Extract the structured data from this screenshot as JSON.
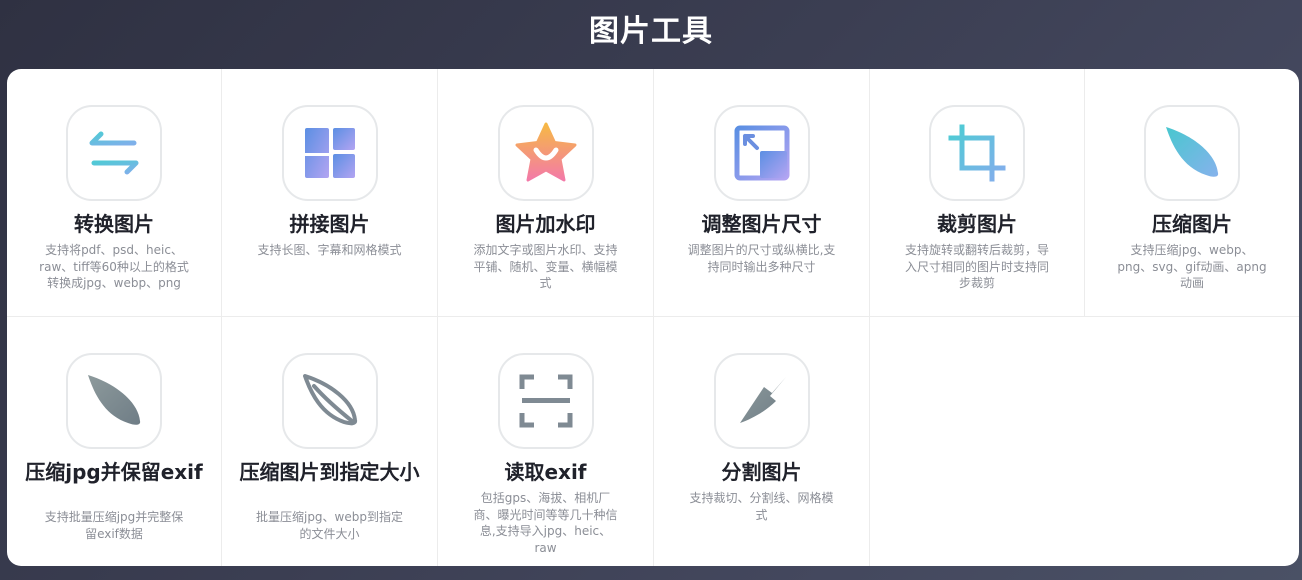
{
  "header": {
    "title": "图片工具"
  },
  "tools": [
    {
      "title": "转换图片",
      "desc": "支持将pdf、psd、heic、raw、tiff等60种以上的格式转换成jpg、webp、png",
      "icon": "convert-arrows-icon"
    },
    {
      "title": "拼接图片",
      "desc": "支持长图、字幕和网格模式",
      "icon": "grid-layout-icon"
    },
    {
      "title": "图片加水印",
      "desc": "添加文字或图片水印、支持平铺、随机、变量、横幅模式",
      "icon": "star-watermark-icon"
    },
    {
      "title": "调整图片尺寸",
      "desc": "调整图片的尺寸或纵横比,支持同时输出多种尺寸",
      "icon": "resize-icon"
    },
    {
      "title": "裁剪图片",
      "desc": "支持旋转或翻转后裁剪，导入尺寸相同的图片时支持同步裁剪",
      "icon": "crop-icon"
    },
    {
      "title": "压缩图片",
      "desc": "支持压缩jpg、webp、png、svg、gif动画、apng动画",
      "icon": "leaf-icon"
    },
    {
      "title": "压缩jpg并保留exif",
      "desc": "支持批量压缩jpg并完整保留exif数据",
      "icon": "leaf-gray-icon"
    },
    {
      "title": "压缩图片到指定大小",
      "desc": "批量压缩jpg、webp到指定的文件大小",
      "icon": "leaf-outline-icon"
    },
    {
      "title": "读取exif",
      "desc": "包括gps、海拔、相机厂商、曝光时间等等几十种信息,支持导入jpg、heic、raw",
      "icon": "scan-icon"
    },
    {
      "title": "分割图片",
      "desc": "支持裁切、分割线、网格模式",
      "icon": "knife-icon"
    }
  ],
  "colors": {
    "teal": "#5cc8d8",
    "blue": "#6b8fe0",
    "purple": "#a99bf0",
    "orange": "#f5b847",
    "pink": "#f07da4",
    "gray": "#7f8a93"
  }
}
